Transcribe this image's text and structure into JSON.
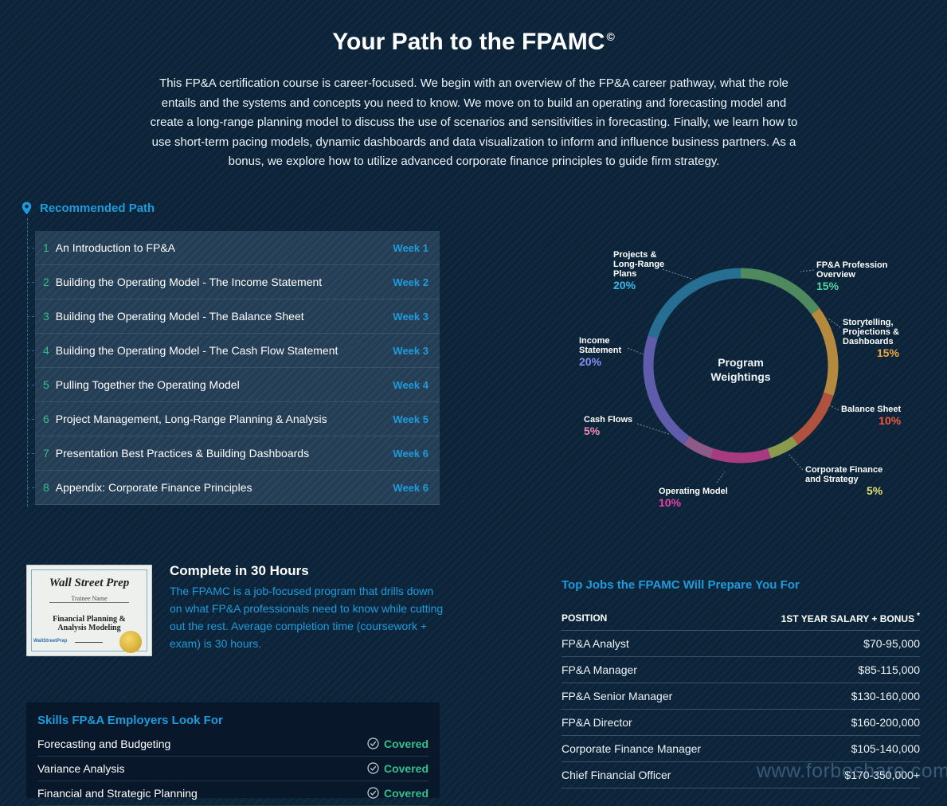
{
  "header": {
    "title": "Your Path to the FPAMC",
    "title_mark": "©",
    "intro": "This FP&A certification course is career-focused. We begin with an overview of the FP&A career pathway, what the role entails and the systems and concepts you need to know. We move on to build an operating and forecasting model and create a long-range planning model to discuss the use of scenarios and sensitivities in forecasting. Finally, we learn how to use short-term pacing models, dynamic dashboards and data visualization to inform and influence business partners. As a bonus, we explore how to utilize advanced corporate finance principles to guide firm strategy."
  },
  "path": {
    "title": "Recommended Path",
    "icon": "map-pin-icon",
    "courses": [
      {
        "num": "1",
        "title": "An Introduction to FP&A",
        "week": "Week 1"
      },
      {
        "num": "2",
        "title": "Building the Operating Model - The Income Statement",
        "week": "Week 2"
      },
      {
        "num": "3",
        "title": "Building the Operating Model - The Balance Sheet",
        "week": "Week 3"
      },
      {
        "num": "4",
        "title": "Building the Operating Model - The Cash Flow Statement",
        "week": "Week 3"
      },
      {
        "num": "5",
        "title": "Pulling Together the Operating Model",
        "week": "Week 4"
      },
      {
        "num": "6",
        "title": "Project Management, Long-Range Planning & Analysis",
        "week": "Week 5"
      },
      {
        "num": "7",
        "title": "Presentation Best Practices & Building Dashboards",
        "week": "Week 6"
      },
      {
        "num": "8",
        "title": "Appendix: Corporate Finance Principles",
        "week": "Week 6"
      }
    ]
  },
  "donut": {
    "center_line1": "Program",
    "center_line2": "Weightings",
    "segments": [
      {
        "lines": [
          "FP&A Profession",
          "Overview"
        ],
        "pct": "15%",
        "value": 15,
        "color": "#4f8a5e",
        "pct_color": "#4fd4a0"
      },
      {
        "lines": [
          "Storytelling,",
          "Projections &",
          "Dashboards"
        ],
        "pct": "15%",
        "value": 15,
        "color": "#b58a3e",
        "pct_color": "#f0a640"
      },
      {
        "lines": [
          "Balance Sheet"
        ],
        "pct": "10%",
        "value": 10,
        "color": "#b0523e",
        "pct_color": "#f05a3c"
      },
      {
        "lines": [
          "Corporate Finance",
          "and Strategy"
        ],
        "pct": "5%",
        "value": 5,
        "color": "#8c9a4e",
        "pct_color": "#e4e078"
      },
      {
        "lines": [
          "Operating Model"
        ],
        "pct": "10%",
        "value": 10,
        "color": "#a83a82",
        "pct_color": "#e640a6"
      },
      {
        "lines": [
          "Cash Flows"
        ],
        "pct": "5%",
        "value": 5,
        "color": "#8e5a88",
        "pct_color": "#f08aba"
      },
      {
        "lines": [
          "Income",
          "Statement"
        ],
        "pct": "20%",
        "value": 20,
        "color": "#5e5cab",
        "pct_color": "#8a8cf0"
      },
      {
        "lines": [
          "Projects &",
          "Long-Range",
          "Plans"
        ],
        "pct": "20%",
        "value": 20,
        "color": "#266e92",
        "pct_color": "#34b8ea"
      }
    ]
  },
  "certificate": {
    "brand": "Wall Street Prep",
    "trainee": "Trainee Name",
    "course_line1": "Financial Planning &",
    "course_line2": "Analysis Modeling",
    "footer_brand": "WallStreetPrep"
  },
  "complete": {
    "title": "Complete in 30 Hours",
    "desc": "The FPAMC is a job-focused program that drills down on what FP&A professionals need to know while cutting out the rest. Average completion time (coursework + exam) is 30 hours."
  },
  "skills": {
    "title": "Skills FP&A Employers Look For",
    "rows": [
      {
        "name": "Forecasting and Budgeting",
        "status": "Covered"
      },
      {
        "name": "Variance Analysis",
        "status": "Covered"
      },
      {
        "name": "Financial and Strategic Planning",
        "status": "Covered"
      }
    ]
  },
  "jobs": {
    "title": "Top Jobs the FPAMC Will Prepare You For",
    "col_position": "POSITION",
    "col_salary": "1ST YEAR SALARY + BONUS",
    "col_salary_mark": "*",
    "rows": [
      {
        "position": "FP&A Analyst",
        "salary": "$70-95,000"
      },
      {
        "position": "FP&A Manager",
        "salary": "$85-115,000"
      },
      {
        "position": "FP&A Senior Manager",
        "salary": "$130-160,000"
      },
      {
        "position": "FP&A Director",
        "salary": "$160-200,000"
      },
      {
        "position": "Corporate Finance Manager",
        "salary": "$105-140,000"
      },
      {
        "position": "Chief Financial Officer",
        "salary": "$170-350,000+"
      }
    ]
  },
  "watermark": "www.forbeshare.com"
}
